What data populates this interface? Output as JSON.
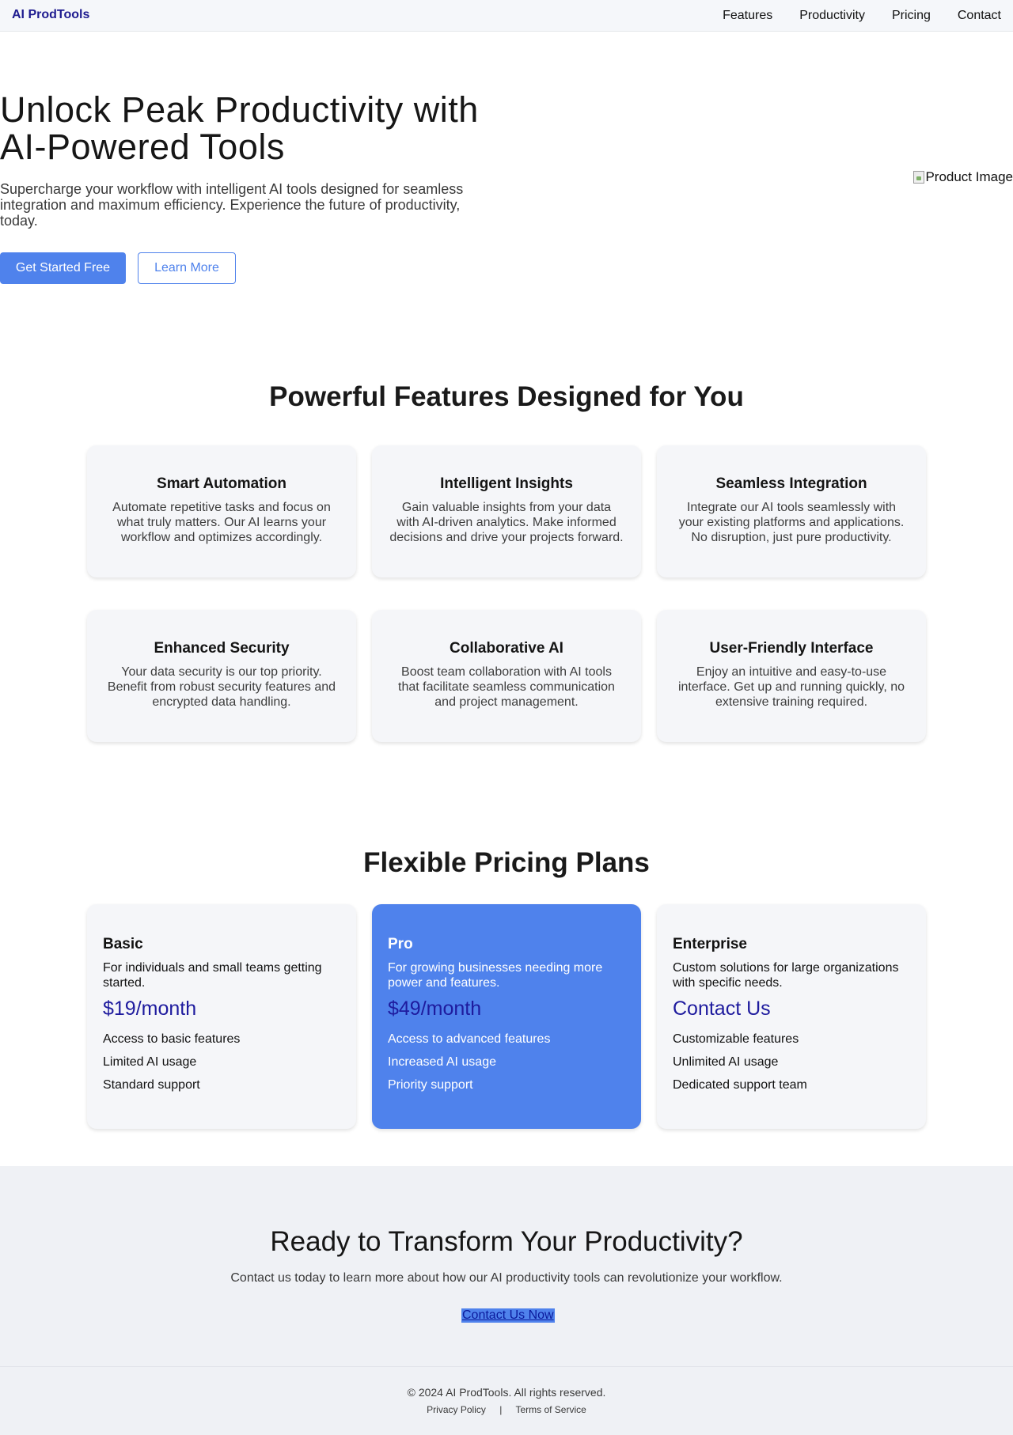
{
  "nav": {
    "brand": "AI ProdTools",
    "links": [
      "Features",
      "Productivity",
      "Pricing",
      "Contact"
    ]
  },
  "hero": {
    "title": "Unlock Peak Productivity with AI-Powered Tools",
    "subtitle": "Supercharge your workflow with intelligent AI tools designed for seamless integration and maximum efficiency. Experience the future of productivity, today.",
    "primary_cta": "Get Started Free",
    "secondary_cta": "Learn More",
    "image_alt": "Product Image"
  },
  "features": {
    "title": "Powerful Features Designed for You",
    "items": [
      {
        "title": "Smart Automation",
        "desc": "Automate repetitive tasks and focus on what truly matters. Our AI learns your workflow and optimizes accordingly."
      },
      {
        "title": "Intelligent Insights",
        "desc": "Gain valuable insights from your data with AI-driven analytics. Make informed decisions and drive your projects forward."
      },
      {
        "title": "Seamless Integration",
        "desc": "Integrate our AI tools seamlessly with your existing platforms and applications. No disruption, just pure productivity."
      },
      {
        "title": "Enhanced Security",
        "desc": "Your data security is our top priority. Benefit from robust security features and encrypted data handling."
      },
      {
        "title": "Collaborative AI",
        "desc": "Boost team collaboration with AI tools that facilitate seamless communication and project management."
      },
      {
        "title": "User-Friendly Interface",
        "desc": "Enjoy an intuitive and easy-to-use interface. Get up and running quickly, no extensive training required."
      }
    ]
  },
  "pricing": {
    "title": "Flexible Pricing Plans",
    "plans": [
      {
        "name": "Basic",
        "desc": "For individuals and small teams getting started.",
        "price": "$19/month",
        "features": [
          "Access to basic features",
          "Limited AI usage",
          "Standard support"
        ]
      },
      {
        "name": "Pro",
        "desc": "For growing businesses needing more power and features.",
        "price": "$49/month",
        "features": [
          "Access to advanced features",
          "Increased AI usage",
          "Priority support"
        ]
      },
      {
        "name": "Enterprise",
        "desc": "Custom solutions for large organizations with specific needs.",
        "price": "Contact Us",
        "features": [
          "Customizable features",
          "Unlimited AI usage",
          "Dedicated support team"
        ]
      }
    ]
  },
  "cta": {
    "title": "Ready to Transform Your Productivity?",
    "subtitle": "Contact us today to learn more about how our AI productivity tools can revolutionize your workflow.",
    "link": "Contact Us Now"
  },
  "footer": {
    "copyright": "© 2024 AI ProdTools. All rights reserved.",
    "privacy": "Privacy Policy",
    "separator": "|",
    "terms": "Terms of Service"
  },
  "colors": {
    "accent": "#4f82ec",
    "brand": "#1e1b8f",
    "price": "#1e1b9e",
    "card_bg": "#f5f6f9",
    "cta_bg": "#eff1f5"
  }
}
